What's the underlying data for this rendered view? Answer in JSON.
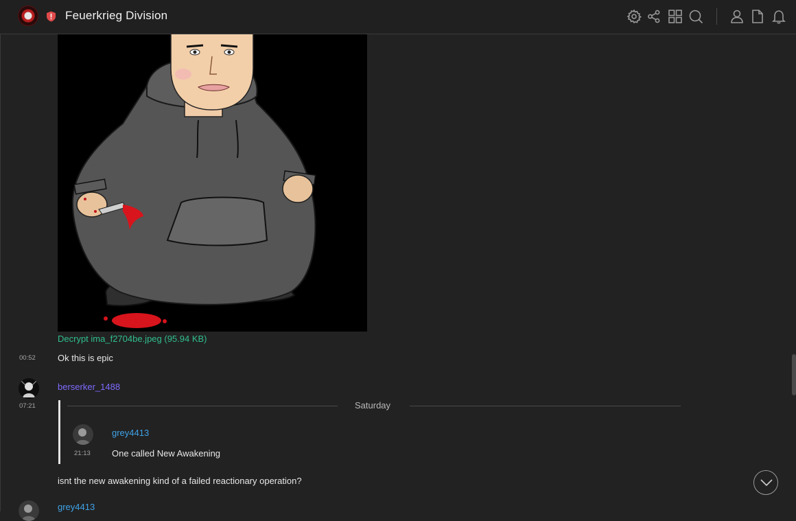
{
  "header": {
    "room_name": "Feuerkrieg Division",
    "icons": [
      "settings-icon",
      "share-icon",
      "apps-grid-icon",
      "search-icon",
      "members-icon",
      "files-icon",
      "notifications-icon"
    ]
  },
  "messages": {
    "image_caption": "Decrypt ima_f2704be.jpeg (95.94 KB)",
    "m1": {
      "time": "00:52",
      "text": "Ok this is epic"
    },
    "m2": {
      "user": "berserker_1488",
      "time": "07:21",
      "user_color": "#7d6bff"
    },
    "date_separator": "Saturday",
    "quoted": {
      "user": "grey4413",
      "time": "21:13",
      "text": "One called New Awakening",
      "user_color": "#3fa2e8"
    },
    "m2_text": "isnt the new awakening kind of a failed reactionary operation?",
    "m3": {
      "user": "grey4413",
      "user_color": "#3fa2e8"
    }
  },
  "colors": {
    "accent_link": "#2fbf8f",
    "background": "#222222"
  }
}
